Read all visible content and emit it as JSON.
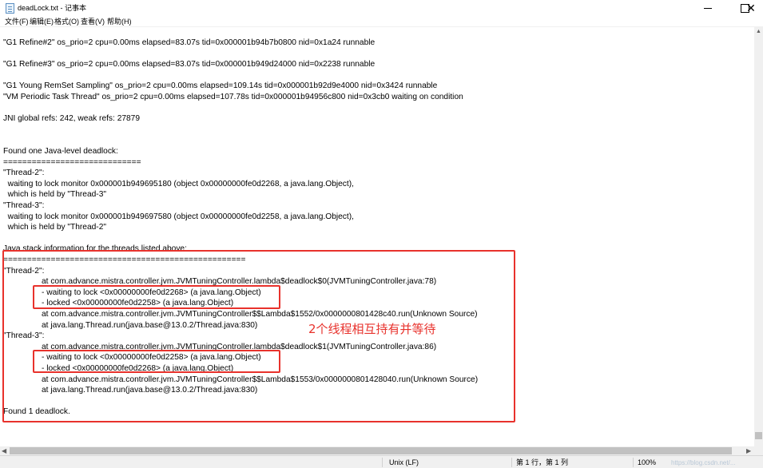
{
  "window": {
    "title": "deadLock.txt - 记事本",
    "icon": "notepad-icon",
    "controls": {
      "minimize": "minimize-icon",
      "maximize": "maximize-icon",
      "close": "✕"
    }
  },
  "menu": [
    {
      "label": "文件(F)"
    },
    {
      "label": "编辑(E)"
    },
    {
      "label": "格式(O)"
    },
    {
      "label": "查看(V)"
    },
    {
      "label": "帮助(H)"
    }
  ],
  "lines": [
    "\"G1 Refine#2\" os_prio=2 cpu=0.00ms elapsed=83.07s tid=0x000001b94b7b0800 nid=0x1a24 runnable",
    "",
    "\"G1 Refine#3\" os_prio=2 cpu=0.00ms elapsed=83.07s tid=0x000001b949d24000 nid=0x2238 runnable",
    "",
    "\"G1 Young RemSet Sampling\" os_prio=2 cpu=0.00ms elapsed=109.14s tid=0x000001b92d9e4000 nid=0x3424 runnable",
    "\"VM Periodic Task Thread\" os_prio=2 cpu=0.00ms elapsed=107.78s tid=0x000001b94956c800 nid=0x3cb0 waiting on condition",
    "",
    "JNI global refs: 242, weak refs: 27879",
    "",
    "",
    "Found one Java-level deadlock:",
    "=============================",
    "\"Thread-2\":",
    "  waiting to lock monitor 0x000001b949695180 (object 0x00000000fe0d2268, a java.lang.Object),",
    "  which is held by \"Thread-3\"",
    "\"Thread-3\":",
    "  waiting to lock monitor 0x000001b949697580 (object 0x00000000fe0d2258, a java.lang.Object),",
    "  which is held by \"Thread-2\"",
    "",
    "Java stack information for the threads listed above:",
    "===================================================",
    "\"Thread-2\":",
    "\tat com.advance.mistra.controller.jvm.JVMTuningController.lambda$deadlock$0(JVMTuningController.java:78)",
    "\t- waiting to lock <0x00000000fe0d2268> (a java.lang.Object)",
    "\t- locked <0x00000000fe0d2258> (a java.lang.Object)",
    "\tat com.advance.mistra.controller.jvm.JVMTuningController$$Lambda$1552/0x0000000801428c40.run(Unknown Source)",
    "\tat java.lang.Thread.run(java.base@13.0.2/Thread.java:830)",
    "\"Thread-3\":",
    "\tat com.advance.mistra.controller.jvm.JVMTuningController.lambda$deadlock$1(JVMTuningController.java:86)",
    "\t- waiting to lock <0x00000000fe0d2258> (a java.lang.Object)",
    "\t- locked <0x00000000fe0d2268> (a java.lang.Object)",
    "\tat com.advance.mistra.controller.jvm.JVMTuningController$$Lambda$1553/0x0000000801428040.run(Unknown Source)",
    "\tat java.lang.Thread.run(java.base@13.0.2/Thread.java:830)",
    "",
    "Found 1 deadlock."
  ],
  "annotation": {
    "text": "2个线程相互持有并等待",
    "color": "#e8322c"
  },
  "status": {
    "line_ending": "Unix (LF)",
    "cursor": "第 1 行，第 1 列",
    "zoom": "100%",
    "watermark": "https://blog.csdn.net/..."
  },
  "colors": {
    "annotation": "#e8322c",
    "statusbar_bg": "#f0f0f0"
  }
}
